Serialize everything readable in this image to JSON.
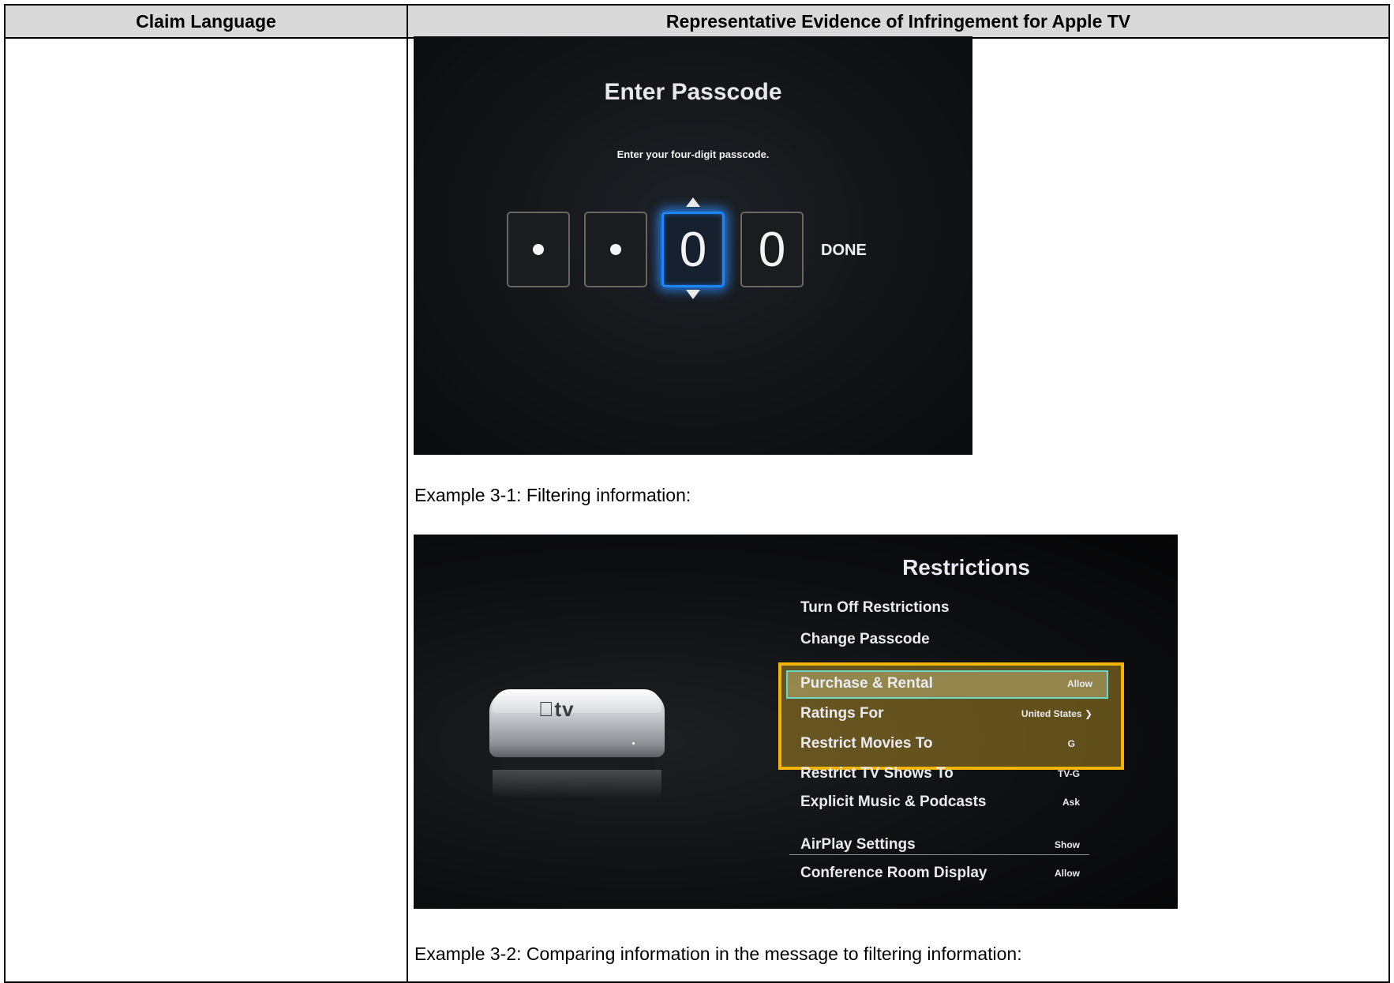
{
  "table": {
    "header_left": "Claim Language",
    "header_right": "Representative Evidence of Infringement for Apple TV"
  },
  "screenshot1": {
    "title": "Enter Passcode",
    "subtitle": "Enter your four-digit passcode.",
    "digits": [
      "•",
      "•",
      "0",
      "0"
    ],
    "active_digit_index": 2,
    "done_label": "DONE"
  },
  "caption1": "Example 3-1: Filtering information:",
  "screenshot2": {
    "title": "Restrictions",
    "device_logo": "tv",
    "items": [
      {
        "label": "Turn Off Restrictions",
        "value": ""
      },
      {
        "label": "Change Passcode",
        "value": ""
      },
      {
        "label": "Purchase & Rental",
        "value": "Allow"
      },
      {
        "label": "Ratings For",
        "value": "United States ❯"
      },
      {
        "label": "Restrict Movies To",
        "value": "G"
      },
      {
        "label": "Restrict TV Shows To",
        "value": "TV-G"
      },
      {
        "label": "Explicit Music & Podcasts",
        "value": "Ask"
      },
      {
        "label": "AirPlay Settings",
        "value": "Show"
      },
      {
        "label": "Conference Room Display",
        "value": "Allow"
      }
    ],
    "highlight_color": "#f4b400"
  },
  "caption2": "Example 3-2: Comparing information in the message to filtering information:"
}
